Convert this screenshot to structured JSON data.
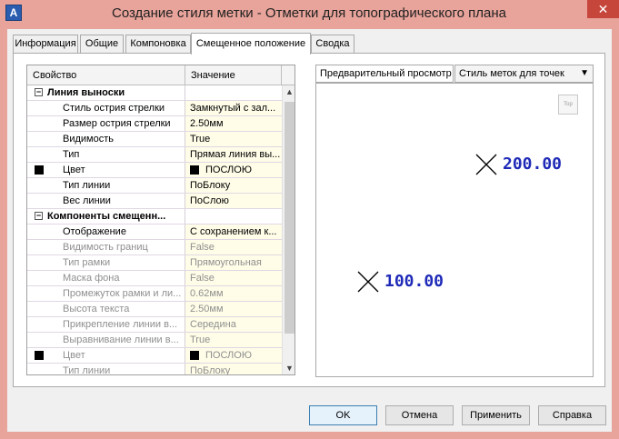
{
  "window": {
    "app_icon_letter": "A",
    "title": "Создание стиля метки - Отметки для топографического плана",
    "close_glyph": "✕"
  },
  "tabs": [
    {
      "label": "Информация"
    },
    {
      "label": "Общие"
    },
    {
      "label": "Компоновка"
    },
    {
      "label": "Смещенное положение",
      "active": true
    },
    {
      "label": "Сводка"
    }
  ],
  "grid": {
    "col_property": "Свойство",
    "col_value": "Значение",
    "rows": [
      {
        "kind": "cat",
        "expander": "−",
        "label": "Линия выноски",
        "value": ""
      },
      {
        "kind": "prop",
        "label": "Стиль острия стрелки",
        "value": "Замкнутый с зал..."
      },
      {
        "kind": "prop",
        "label": "Размер острия стрелки",
        "value": "2.50мм"
      },
      {
        "kind": "prop",
        "label": "Видимость",
        "value": "True"
      },
      {
        "kind": "prop",
        "label": "Тип",
        "value": "Прямая линия вы..."
      },
      {
        "kind": "prop",
        "label": "Цвет",
        "value": "ПОСЛОЮ",
        "swatch": true
      },
      {
        "kind": "prop",
        "label": "Тип линии",
        "value": "ПоБлоку"
      },
      {
        "kind": "prop",
        "label": "Вес линии",
        "value": "ПоСлою"
      },
      {
        "kind": "cat",
        "expander": "−",
        "label": "Компоненты смещенн...",
        "value": ""
      },
      {
        "kind": "prop",
        "label": "Отображение",
        "value": "С сохранением к..."
      },
      {
        "kind": "dim",
        "label": "Видимость границ",
        "value": "False"
      },
      {
        "kind": "dim",
        "label": "Тип рамки",
        "value": "Прямоугольная"
      },
      {
        "kind": "dim",
        "label": "Маска фона",
        "value": "False"
      },
      {
        "kind": "dim",
        "label": "Промежуток рамки и ли...",
        "value": "0.62мм"
      },
      {
        "kind": "dim",
        "label": "Высота текста",
        "value": "2.50мм"
      },
      {
        "kind": "dim",
        "label": "Прикрепление линии в...",
        "value": "Середина"
      },
      {
        "kind": "dim",
        "label": "Выравнивание линии в...",
        "value": "True"
      },
      {
        "kind": "dim",
        "label": "Цвет",
        "value": "ПОСЛОЮ",
        "swatch": true
      },
      {
        "kind": "dim",
        "label": "Тип линии",
        "value": "ПоБлоку"
      }
    ],
    "scroll_up": "▲",
    "scroll_down": "▼"
  },
  "preview": {
    "label": "Предварительный просмотр",
    "style_select": "Стиль меток для точек",
    "select_arrow": "▼",
    "viewcube_text": "Top",
    "points": [
      {
        "marker": "x",
        "label": "200.00"
      },
      {
        "marker": "x",
        "label": "100.00"
      }
    ],
    "label_color": "#1f2bb8"
  },
  "buttons": {
    "ok": "OK",
    "cancel": "Отмена",
    "apply": "Применить",
    "help": "Справка"
  }
}
